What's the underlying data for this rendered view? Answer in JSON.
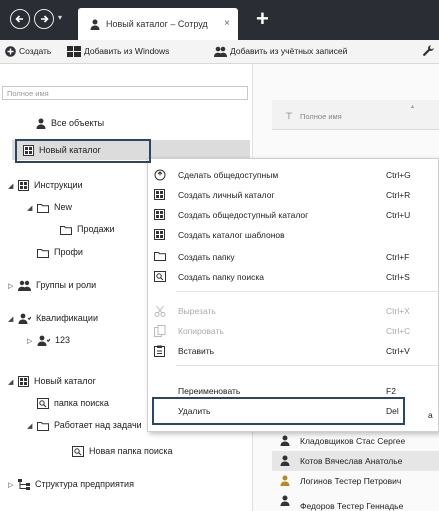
{
  "titlebar": {
    "tab_title": "Новый каталог – Сотруд",
    "tab_close": "×",
    "new_tab": "+",
    "nav_drop": "▾",
    "colors": {
      "bg": "#2a2d34",
      "tab": "#ffffff"
    }
  },
  "toolbar": {
    "create_label": "Создать",
    "add_windows_label": "Добавить из Windows",
    "add_accounts_label": "Добавить из учётных записей"
  },
  "search": {
    "placeholder": "Полное имя"
  },
  "tree": [
    {
      "label": "Все объекты",
      "icon": "person-icon",
      "expander": ""
    },
    {
      "label": "Новый каталог",
      "icon": "catalog-icon",
      "expander": ""
    },
    {
      "label": "Инструкции",
      "icon": "catalog-icon",
      "expander": "◢"
    },
    {
      "label": "New",
      "icon": "folder-icon",
      "expander": "◢"
    },
    {
      "label": "Продажи",
      "icon": "folder-icon",
      "expander": ""
    },
    {
      "label": "Профи",
      "icon": "folder-icon",
      "expander": ""
    },
    {
      "label": "Группы и роли",
      "icon": "group-icon",
      "expander": "▷"
    },
    {
      "label": "Квалификации",
      "icon": "qualification-icon",
      "expander": "◢"
    },
    {
      "label": "123",
      "icon": "qualification-icon",
      "expander": "▷"
    },
    {
      "label": "Новый каталог",
      "icon": "catalog-icon",
      "expander": "◢"
    },
    {
      "label": "папка поиска",
      "icon": "search-folder-icon",
      "expander": ""
    },
    {
      "label": "Работает над задачи",
      "icon": "folder-icon",
      "expander": "◢"
    },
    {
      "label": "Новая папка поиска",
      "icon": "search-folder-icon",
      "expander": ""
    },
    {
      "label": "Структура предприятия",
      "icon": "org-structure-icon",
      "expander": "▷"
    }
  ],
  "grid": {
    "column_title": "Полное имя",
    "filter_glyph": "⊤",
    "sort_glyph": "▴",
    "rows": [
      {
        "text": "Кладовщиков Стас Сергее",
        "icon": "person-icon"
      },
      {
        "text": "Котов Вячеслав Анатолье",
        "icon": "person-icon"
      },
      {
        "text": "Логинов Тестер Петрович",
        "icon": "person-icon"
      },
      {
        "text": "Федоров Тестер Геннадье",
        "icon": "person-icon"
      }
    ],
    "partial_char": "а"
  },
  "context_menu": {
    "items": [
      {
        "label": "Сделать общедоступным",
        "shortcut": "Ctrl+G",
        "icon": "share-icon",
        "disabled": false
      },
      {
        "label": "Создать личный каталог",
        "shortcut": "Ctrl+R",
        "icon": "catalog-icon",
        "disabled": false
      },
      {
        "label": "Создать общедоступный каталог",
        "shortcut": "Ctrl+U",
        "icon": "catalog-icon",
        "disabled": false
      },
      {
        "label": "Создать каталог шаблонов",
        "shortcut": "",
        "icon": "catalog-icon",
        "disabled": false
      },
      {
        "label": "Создать папку",
        "shortcut": "Ctrl+F",
        "icon": "folder-icon",
        "disabled": false
      },
      {
        "label": "Создать папку поиска",
        "shortcut": "Ctrl+S",
        "icon": "search-folder-icon",
        "disabled": false
      },
      {
        "label": "Вырезать",
        "shortcut": "Ctrl+X",
        "icon": "cut-icon",
        "disabled": true
      },
      {
        "label": "Копировать",
        "shortcut": "Ctrl+C",
        "icon": "copy-icon",
        "disabled": true
      },
      {
        "label": "Вставить",
        "shortcut": "Ctrl+V",
        "icon": "paste-icon",
        "disabled": false
      },
      {
        "label": "Переименовать",
        "shortcut": "F2",
        "icon": "",
        "disabled": false
      },
      {
        "label": "Удалить",
        "shortcut": "Del",
        "icon": "",
        "disabled": false
      }
    ]
  },
  "highlight_color": "#2b4569"
}
